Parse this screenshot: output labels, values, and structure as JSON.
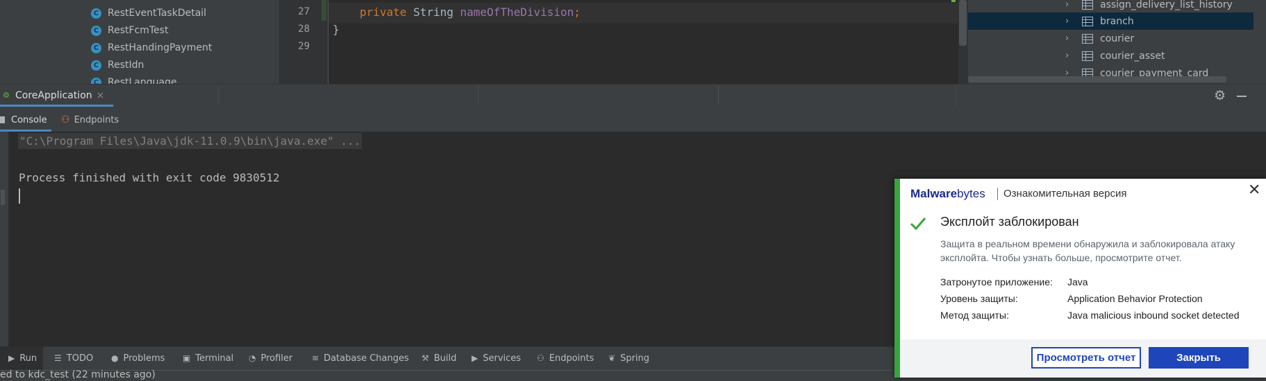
{
  "project_tree": {
    "items": [
      {
        "label": "RestEventTaskDetail",
        "icon": "class-icon"
      },
      {
        "label": "RestFcmTest",
        "icon": "class-icon"
      },
      {
        "label": "RestHandingPayment",
        "icon": "class-icon"
      },
      {
        "label": "RestIdn",
        "icon": "class-icon"
      },
      {
        "label": "RestLanguage",
        "icon": "class-icon"
      }
    ]
  },
  "editor": {
    "line_numbers": [
      "27",
      "28",
      "29"
    ],
    "code": {
      "keyword": "private",
      "type": "String",
      "field": "nameOfTheDivision",
      "semicolon": ";",
      "closing_brace": "}"
    }
  },
  "database_panel": {
    "items": [
      {
        "label": "assign_delivery_list_history",
        "selected": false
      },
      {
        "label": "branch",
        "selected": true
      },
      {
        "label": "courier",
        "selected": false
      },
      {
        "label": "courier_asset",
        "selected": false
      },
      {
        "label": "courier_payment_card",
        "selected": false
      }
    ]
  },
  "run_window": {
    "tab_label": "CoreApplication",
    "tab_close": "×",
    "tabs": {
      "console": "Console",
      "endpoints": "Endpoints"
    },
    "settings_icon": "gear-icon",
    "minimize_icon": "minimize-icon"
  },
  "console": {
    "command": "\"C:\\Program Files\\Java\\jdk-11.0.9\\bin\\java.exe\" ...",
    "exit_message": "Process finished with exit code 9830512"
  },
  "bottom_toolbar": {
    "items": [
      "Run",
      "TODO",
      "Problems",
      "Terminal",
      "Profiler",
      "Database Changes",
      "Build",
      "Services",
      "Endpoints",
      "Spring"
    ]
  },
  "status_bar": {
    "text": "ed to kdc_test (22 minutes ago)"
  },
  "notification": {
    "brand_bold": "Malware",
    "brand_light": "bytes",
    "edition": "Ознакомительная версия",
    "title": "Эксплойт заблокирован",
    "description": "Защита в реальном времени обнаружила и заблокировала атаку эксплойта. Чтобы узнать больше, просмотрите отчет.",
    "details": [
      {
        "label": "Затронутое приложение:",
        "value": "Java"
      },
      {
        "label": "Уровень защиты:",
        "value": "Application Behavior Protection"
      },
      {
        "label": "Метод защиты:",
        "value": "Java malicious inbound socket detected"
      }
    ],
    "view_report_button": "Просмотреть отчет",
    "close_button": "Закрыть",
    "accent_color": "#37a53c",
    "button_color": "#1e45b9"
  }
}
